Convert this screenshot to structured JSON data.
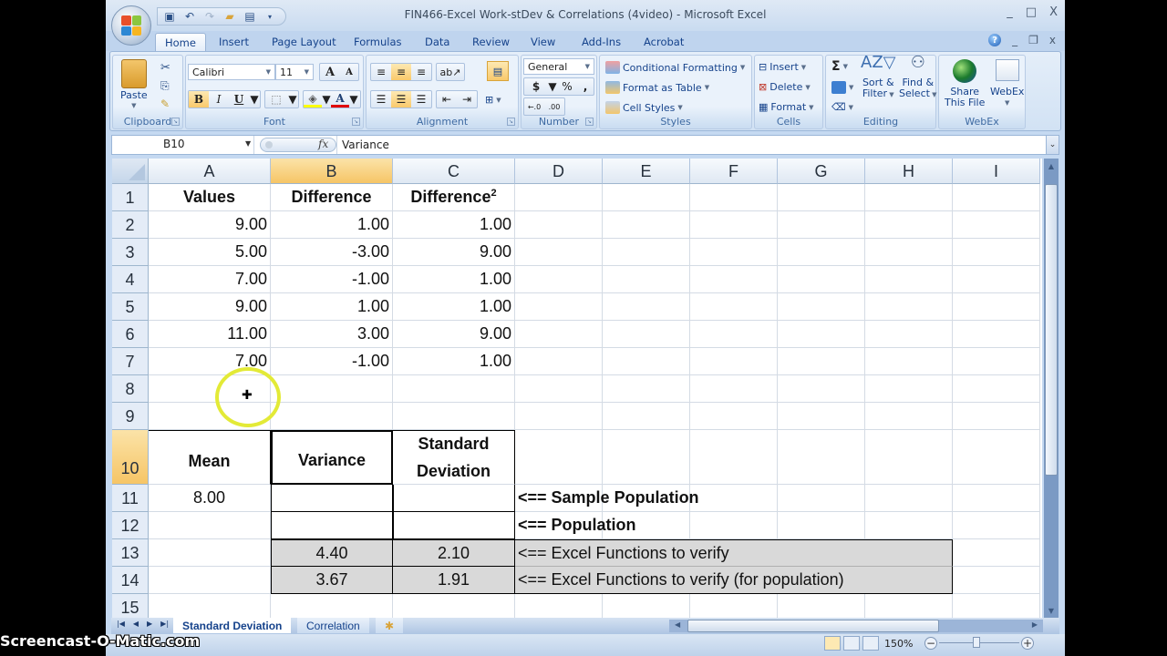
{
  "window": {
    "title": "FIN466-Excel Work-stDev & Correlations (4video) - Microsoft Excel",
    "controls": [
      "_",
      "□",
      "X"
    ]
  },
  "ribbon_tabs": [
    "Home",
    "Insert",
    "Page Layout",
    "Formulas",
    "Data",
    "Review",
    "View",
    "Add-Ins",
    "Acrobat"
  ],
  "active_tab": "Home",
  "ribbon": {
    "clipboard": {
      "label": "Clipboard",
      "paste": "Paste"
    },
    "font": {
      "label": "Font",
      "name": "Calibri",
      "size": "11",
      "bold": "B",
      "italic": "I",
      "underline": "U",
      "grow": "A",
      "shrink": "A",
      "font_color": "A"
    },
    "alignment": {
      "label": "Alignment"
    },
    "number": {
      "label": "Number",
      "format": "General",
      "currency": "$",
      "percent": "%",
      "comma": ",",
      "inc_dec": "←.0 .00",
      "dec_dec": ".00 →.0"
    },
    "styles": {
      "label": "Styles",
      "conditional": "Conditional Formatting",
      "format_table": "Format as Table",
      "cell_styles": "Cell Styles"
    },
    "cells": {
      "label": "Cells",
      "insert": "Insert",
      "delete": "Delete",
      "format": "Format"
    },
    "editing": {
      "label": "Editing",
      "sigma": "Σ",
      "sort_1": "Sort &",
      "sort_2": "Filter",
      "find_1": "Find &",
      "find_2": "Select"
    },
    "webex": {
      "label": "WebEx",
      "share_1": "Share",
      "share_2": "This File",
      "webex": "WebEx"
    }
  },
  "formula_bar": {
    "name_box": "B10",
    "fx": "fx",
    "value": "Variance"
  },
  "columns": [
    "A",
    "B",
    "C",
    "D",
    "E",
    "F",
    "G",
    "H",
    "I"
  ],
  "selected_column": "B",
  "rows": [
    "1",
    "2",
    "3",
    "4",
    "5",
    "6",
    "7",
    "8",
    "9",
    "10",
    "11",
    "12",
    "13",
    "14",
    "15"
  ],
  "selected_row": "10",
  "cells": {
    "A1": "Values",
    "B1": "Difference",
    "C1": "Difference",
    "C1_sup": "2",
    "A2": "9.00",
    "B2": "1.00",
    "C2": "1.00",
    "A3": "5.00",
    "B3": "-3.00",
    "C3": "9.00",
    "A4": "7.00",
    "B4": "-1.00",
    "C4": "1.00",
    "A5": "9.00",
    "B5": "1.00",
    "C5": "1.00",
    "A6": "11.00",
    "B6": "3.00",
    "C6": "9.00",
    "A7": "7.00",
    "B7": "-1.00",
    "C7": "1.00",
    "A10": "Mean",
    "B10": "Variance",
    "C10_1": "Standard",
    "C10_2": "Deviation",
    "A11": "8.00",
    "D11": "<== Sample Population",
    "D12": "<== Population",
    "B13": "4.40",
    "C13": "2.10",
    "D13": "<== Excel Functions to verify",
    "B14": "3.67",
    "C14": "1.91",
    "D14": "<== Excel Functions to verify (for population)"
  },
  "sheet_tabs": [
    {
      "label": "Standard Deviation",
      "active": true
    },
    {
      "label": "Correlation",
      "active": false
    }
  ],
  "status": {
    "zoom": "150%"
  },
  "watermark": "Screencast-O-Matic.com"
}
